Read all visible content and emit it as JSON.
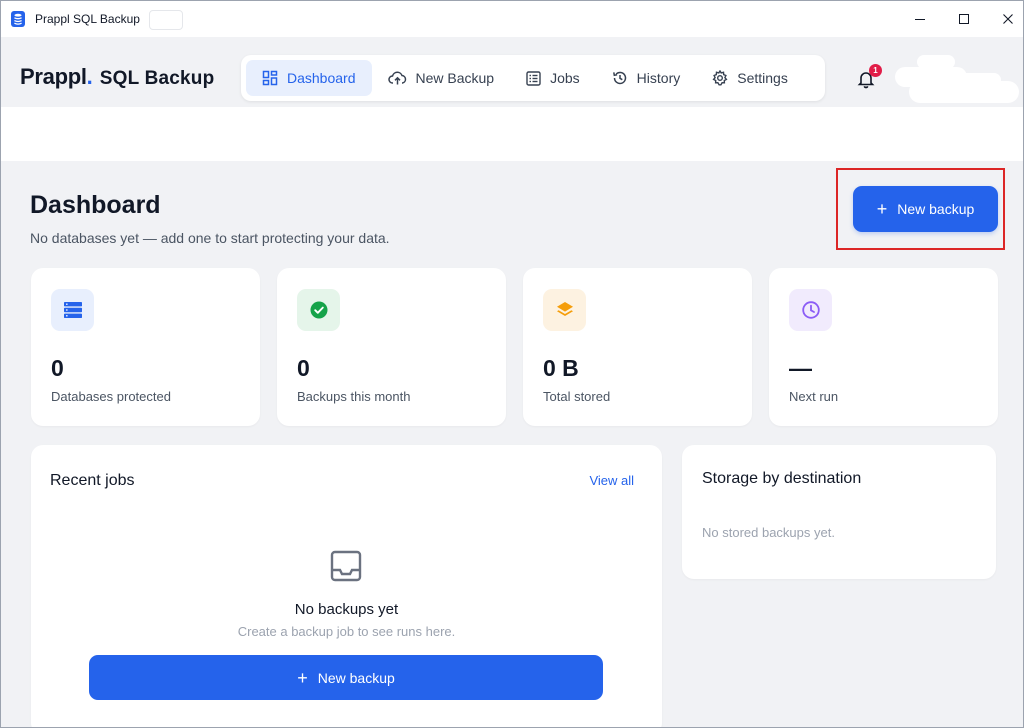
{
  "window": {
    "title": "Prappl SQL Backup",
    "controls": {
      "minimize": "—",
      "maximize": "□",
      "close": "✕"
    },
    "icon": "database-icon"
  },
  "logo": {
    "brand": "Prappl",
    "dot": ".",
    "product": "SQL Backup"
  },
  "nav": {
    "tabs": [
      {
        "label": "Dashboard",
        "icon": "dashboard-grid-icon",
        "active": true
      },
      {
        "label": "New Backup",
        "icon": "cloud-upload-icon",
        "active": false
      },
      {
        "label": "Jobs",
        "icon": "list-icon",
        "active": false
      },
      {
        "label": "History",
        "icon": "history-icon",
        "active": false
      },
      {
        "label": "Settings",
        "icon": "gear-icon",
        "active": false
      }
    ]
  },
  "notifications": {
    "count": "1",
    "icon": "bell-icon"
  },
  "page": {
    "title": "Dashboard",
    "subtitle": "No databases yet — add one to start protecting your data.",
    "new_backup_label": "New backup"
  },
  "stats": [
    {
      "value": "0",
      "label": "Databases protected",
      "icon": "server-stack-icon",
      "bg": "#e8effd",
      "fg": "#2563eb"
    },
    {
      "value": "0",
      "label": "Backups this month",
      "icon": "check-circle-icon",
      "bg": "#e5f5ea",
      "fg": "#16a34a"
    },
    {
      "value": "0 B",
      "label": "Total stored",
      "icon": "layers-icon",
      "bg": "#fdf2e1",
      "fg": "#f59e0b"
    },
    {
      "value": "—",
      "label": "Next run",
      "icon": "clock-icon",
      "bg": "#f1ebfd",
      "fg": "#8b5cf6"
    }
  ],
  "recent_jobs": {
    "title": "Recent jobs",
    "view_all": "View all",
    "empty_title": "No backups yet",
    "empty_subtitle": "Create a backup job to see runs here.",
    "button_label": "New backup",
    "empty_icon": "inbox-icon"
  },
  "storage": {
    "title": "Storage by destination",
    "empty": "No stored backups yet."
  },
  "colors": {
    "accent": "#2563eb",
    "background": "#f1f2f5",
    "badge": "#e11d48",
    "highlight": "#dc2626"
  }
}
